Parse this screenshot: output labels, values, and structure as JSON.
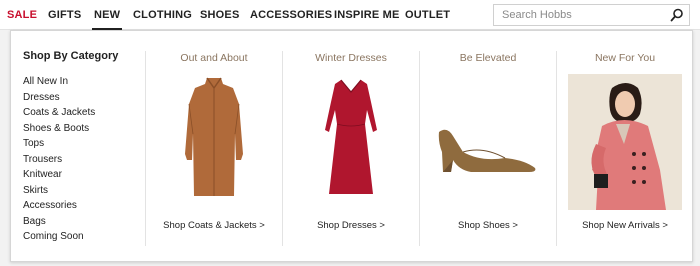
{
  "nav": {
    "items": [
      {
        "label": "SALE"
      },
      {
        "label": "GIFTS"
      },
      {
        "label": "NEW"
      },
      {
        "label": "CLOTHING"
      },
      {
        "label": "SHOES"
      },
      {
        "label": "ACCESSORIES"
      },
      {
        "label": "INSPIRE ME"
      },
      {
        "label": "OUTLET"
      }
    ],
    "active": "NEW"
  },
  "search": {
    "placeholder": "Search Hobbs",
    "icon": "search-icon"
  },
  "menu": {
    "category_heading": "Shop By Category",
    "categories": [
      "All New In",
      "Dresses",
      "Coats & Jackets",
      "Shoes & Boots",
      "Tops",
      "Trousers",
      "Knitwear",
      "Skirts",
      "Accessories",
      "Bags",
      "Coming Soon"
    ],
    "promos": [
      {
        "title": "Out and About",
        "link": "Shop Coats & Jackets >",
        "image": "camel-coat"
      },
      {
        "title": "Winter Dresses",
        "link": "Shop Dresses >",
        "image": "red-dress"
      },
      {
        "title": "Be Elevated",
        "link": "Shop Shoes >",
        "image": "tan-suede-heel"
      },
      {
        "title": "New For You",
        "link": "Shop New Arrivals >",
        "image": "model-pink-coat"
      }
    ]
  },
  "colors": {
    "sale": "#c8102e",
    "promo_title": "#8a7560",
    "coat": "#b06a3a",
    "dress": "#b0162e",
    "shoe": "#8f6b3e",
    "pink_coat": "#e07a7a"
  }
}
